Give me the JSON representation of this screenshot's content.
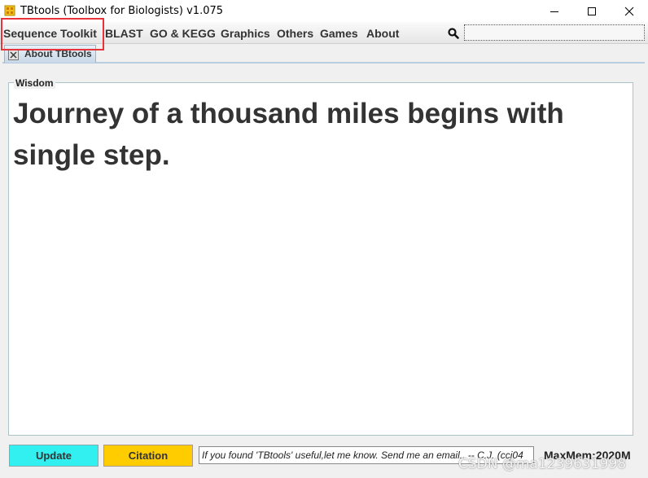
{
  "window": {
    "title": "TBtools (Toolbox for Biologists) v1.075",
    "icon": "tbtools-app-icon"
  },
  "menu": {
    "items": [
      {
        "label": "Sequence Toolkit"
      },
      {
        "label": "BLAST"
      },
      {
        "label": "GO & KEGG"
      },
      {
        "label": "Graphics"
      },
      {
        "label": "Others"
      },
      {
        "label": "Games"
      },
      {
        "label": "About"
      }
    ],
    "highlight_color": "#e8333a"
  },
  "search": {
    "icon": "search-icon",
    "value": ""
  },
  "tab": {
    "label": "About TBtools"
  },
  "wisdom": {
    "legend": "Wisdom",
    "quote": "Journey of a thousand miles begins with single step."
  },
  "footer": {
    "update_label": "Update",
    "update_color": "#33f0f0",
    "citation_label": "Citation",
    "citation_color": "#ffcc00",
    "message": "If you found 'TBtools' useful,let me know. Send me an email.. -- C.J. (ccj04",
    "maxmem": "MaxMem:2020M"
  },
  "watermark": "CSDN @ma1239631998"
}
